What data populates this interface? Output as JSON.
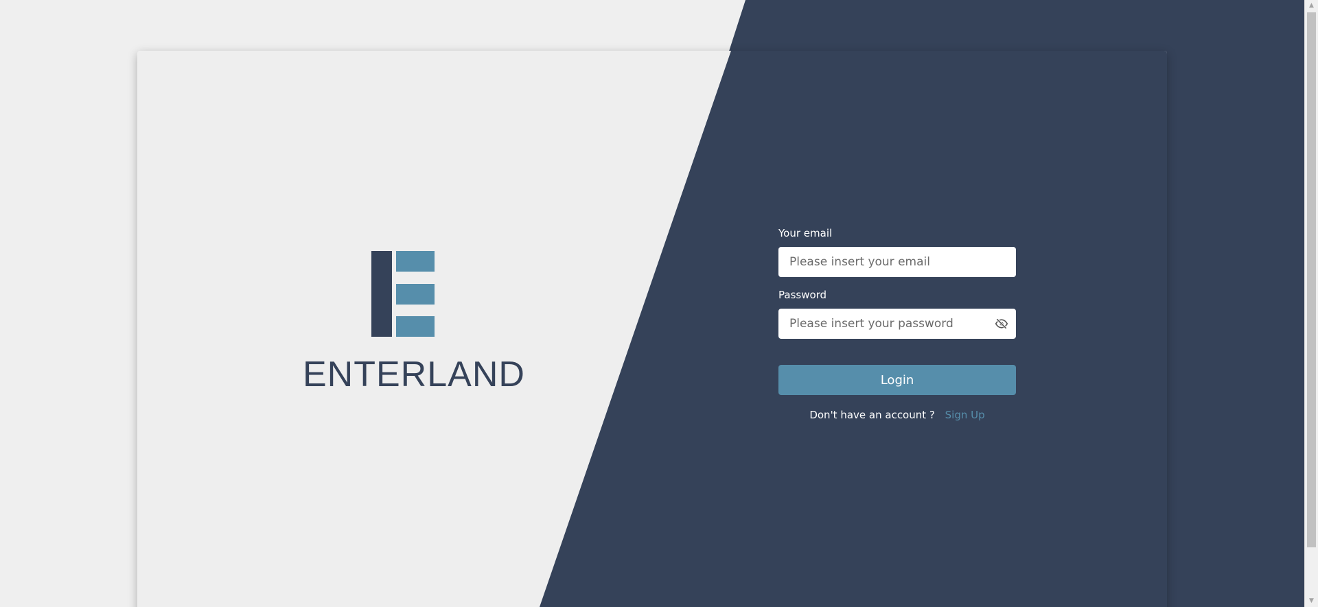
{
  "colors": {
    "background_light": "#efefef",
    "background_dark": "#354259",
    "accent": "#568eab",
    "text_white": "#ffffff"
  },
  "brand": {
    "logo_text": "ENTERLAND"
  },
  "form": {
    "email_label": "Your email",
    "email_placeholder": "Please insert your email",
    "email_value": "",
    "password_label": "Password",
    "password_placeholder": "Please insert your password",
    "password_value": "",
    "password_toggle_icon": "eye-slash-icon",
    "login_label": "Login",
    "no_account_text": "Don't have an account ?",
    "signup_label": "Sign Up"
  },
  "scrollbar": {
    "up_arrow": "▲",
    "down_arrow": "▼"
  }
}
